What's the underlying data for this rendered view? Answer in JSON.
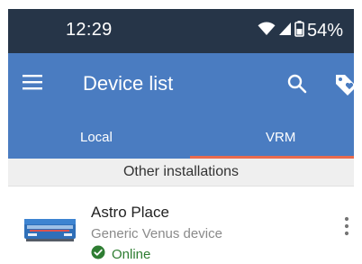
{
  "status_bar": {
    "time": "12:29",
    "battery_percent": "54%",
    "icons": [
      "wifi-icon",
      "cell-signal-icon",
      "battery-icon"
    ]
  },
  "app_bar": {
    "title": "Device list",
    "icons": [
      "menu-icon",
      "search-icon",
      "tag-icon"
    ]
  },
  "tabs": [
    {
      "label": "Local",
      "selected": false
    },
    {
      "label": "VRM",
      "selected": true
    }
  ],
  "section": {
    "header": "Other installations"
  },
  "installations": [
    {
      "name": "Astro Place",
      "device_type": "Generic Venus device",
      "status": "Online",
      "status_icon": "check-circle-icon"
    }
  ],
  "colors": {
    "status_bar": "#263548",
    "app_bar": "#4a7cc1",
    "tab_indicator": "#e86b4e",
    "online": "#2e7d32",
    "section_header_bg": "#efefef"
  }
}
